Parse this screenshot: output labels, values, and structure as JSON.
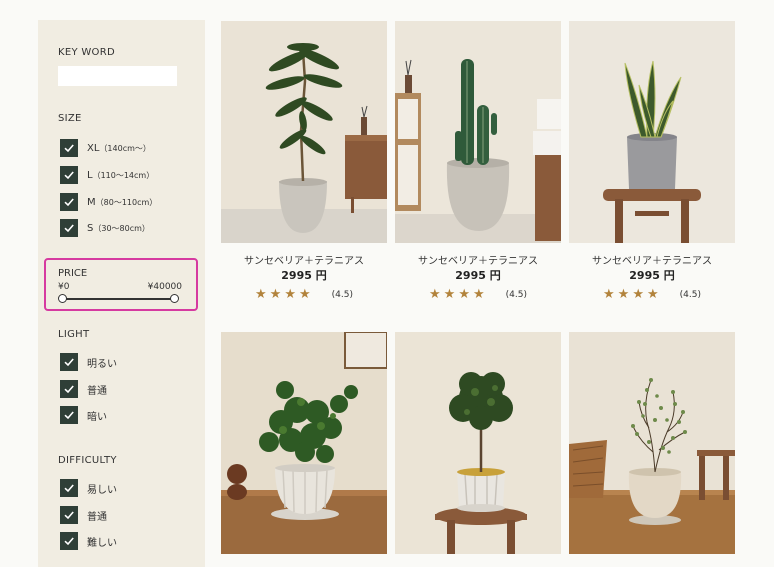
{
  "filters": {
    "keyword": {
      "label": "KEY WORD",
      "value": "",
      "placeholder": ""
    },
    "size": {
      "label": "SIZE",
      "options": [
        {
          "label": "XL",
          "range": "（140cm〜）",
          "checked": true
        },
        {
          "label": "L",
          "range": "（110〜14cm）",
          "checked": true
        },
        {
          "label": "M",
          "range": "（80〜110cm）",
          "checked": true
        },
        {
          "label": "S",
          "range": "（30〜80cm）",
          "checked": true
        }
      ]
    },
    "price": {
      "label": "PRICE",
      "min": "¥0",
      "max": "¥40000"
    },
    "light": {
      "label": "LIGHT",
      "options": [
        {
          "label": "明るい",
          "checked": true
        },
        {
          "label": "普通",
          "checked": true
        },
        {
          "label": "暗い",
          "checked": true
        }
      ]
    },
    "difficulty": {
      "label": "DIFFICULTY",
      "options": [
        {
          "label": "易しい",
          "checked": true
        },
        {
          "label": "普通",
          "checked": true
        },
        {
          "label": "難しい",
          "checked": true
        }
      ]
    }
  },
  "products": [
    {
      "name": "サンセベリア＋テラニアス",
      "price": "2995 円",
      "rating": "(4.5)",
      "stars": 4,
      "image": "tall-leafy-tree-in-gray-pot"
    },
    {
      "name": "サンセベリア＋テラニアス",
      "price": "2995 円",
      "rating": "(4.5)",
      "stars": 4,
      "image": "cactus-in-gray-pot"
    },
    {
      "name": "サンセベリア＋テラニアス",
      "price": "2995 円",
      "rating": "(4.5)",
      "stars": 4,
      "image": "snake-plant-on-stool"
    },
    {
      "name": "",
      "price": "",
      "rating": "",
      "stars": 0,
      "image": "bushy-plant-in-white-pot"
    },
    {
      "name": "",
      "price": "",
      "rating": "",
      "stars": 0,
      "image": "small-tree-on-stool"
    },
    {
      "name": "",
      "price": "",
      "rating": "",
      "stars": 0,
      "image": "wire-plant-in-beige-pot"
    }
  ],
  "colors": {
    "sidebar_bg": "#f1ede2",
    "checkbox": "#2f3f37",
    "star": "#b2833c",
    "highlight": "#d63aa0"
  },
  "icons": {
    "check": "check-icon",
    "star": "star-icon"
  }
}
